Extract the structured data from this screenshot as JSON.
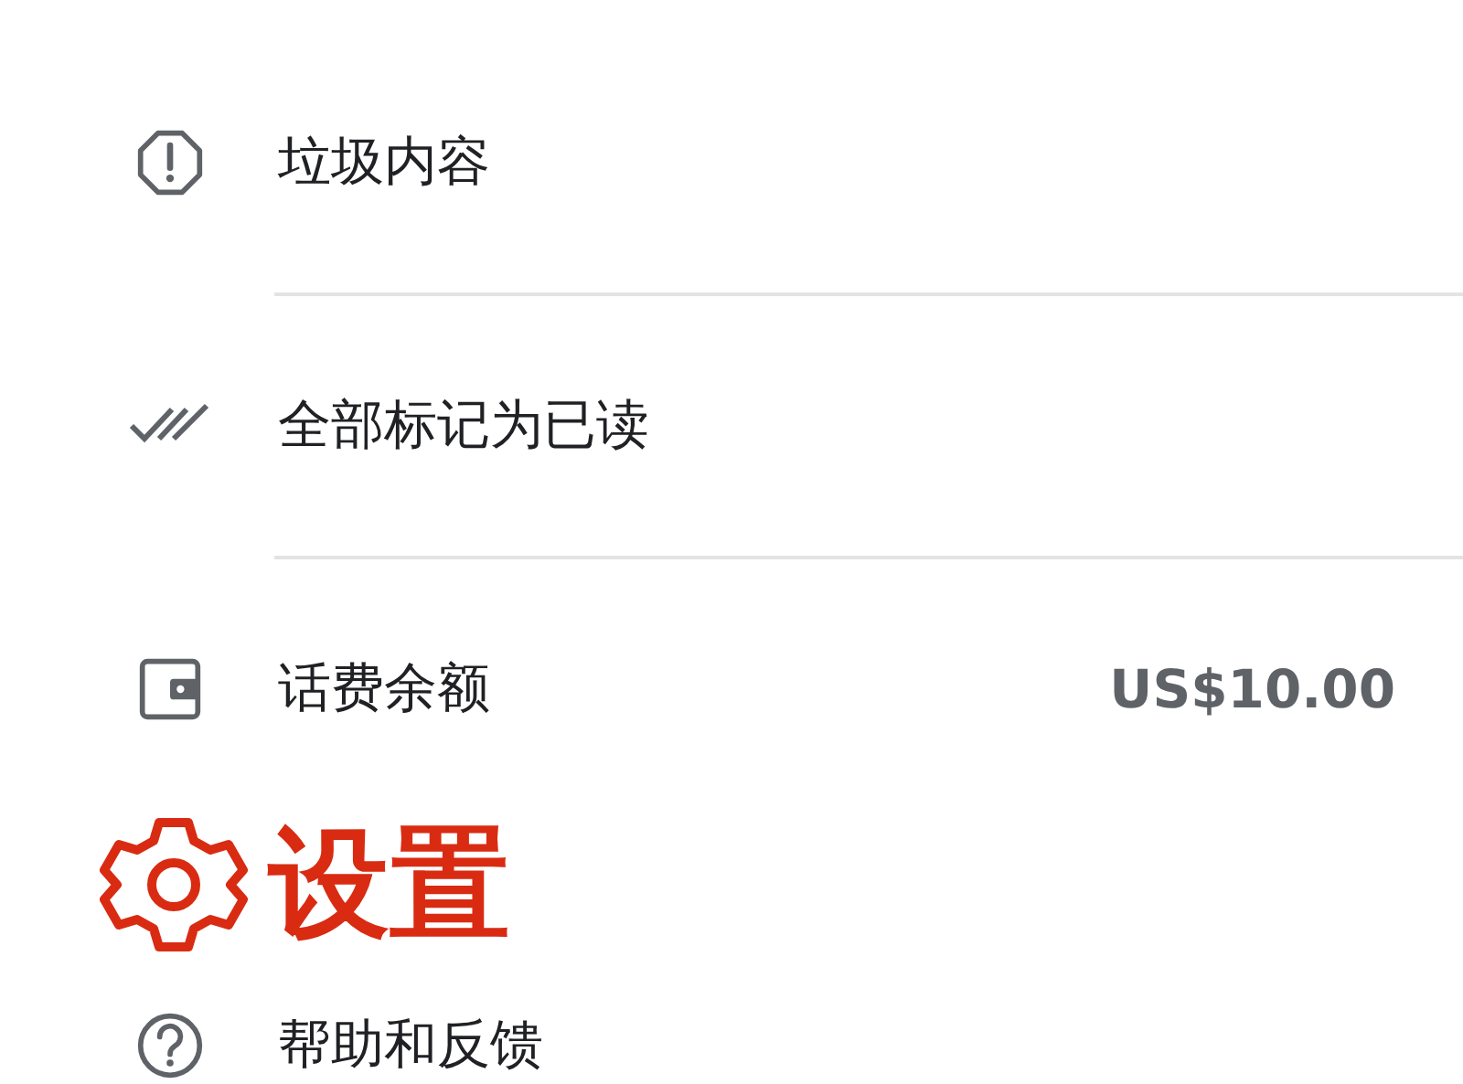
{
  "menu_items": [
    {
      "kind": "spam",
      "label": "垃圾内容"
    },
    {
      "kind": "mark_read",
      "label": "全部标记为已读"
    },
    {
      "kind": "balance",
      "label": "话费余额",
      "value": "US$10.00"
    }
  ],
  "callout": {
    "kind": "settings",
    "label": "设置"
  },
  "bottom_item": {
    "kind": "help",
    "label": "帮助和反馈"
  }
}
